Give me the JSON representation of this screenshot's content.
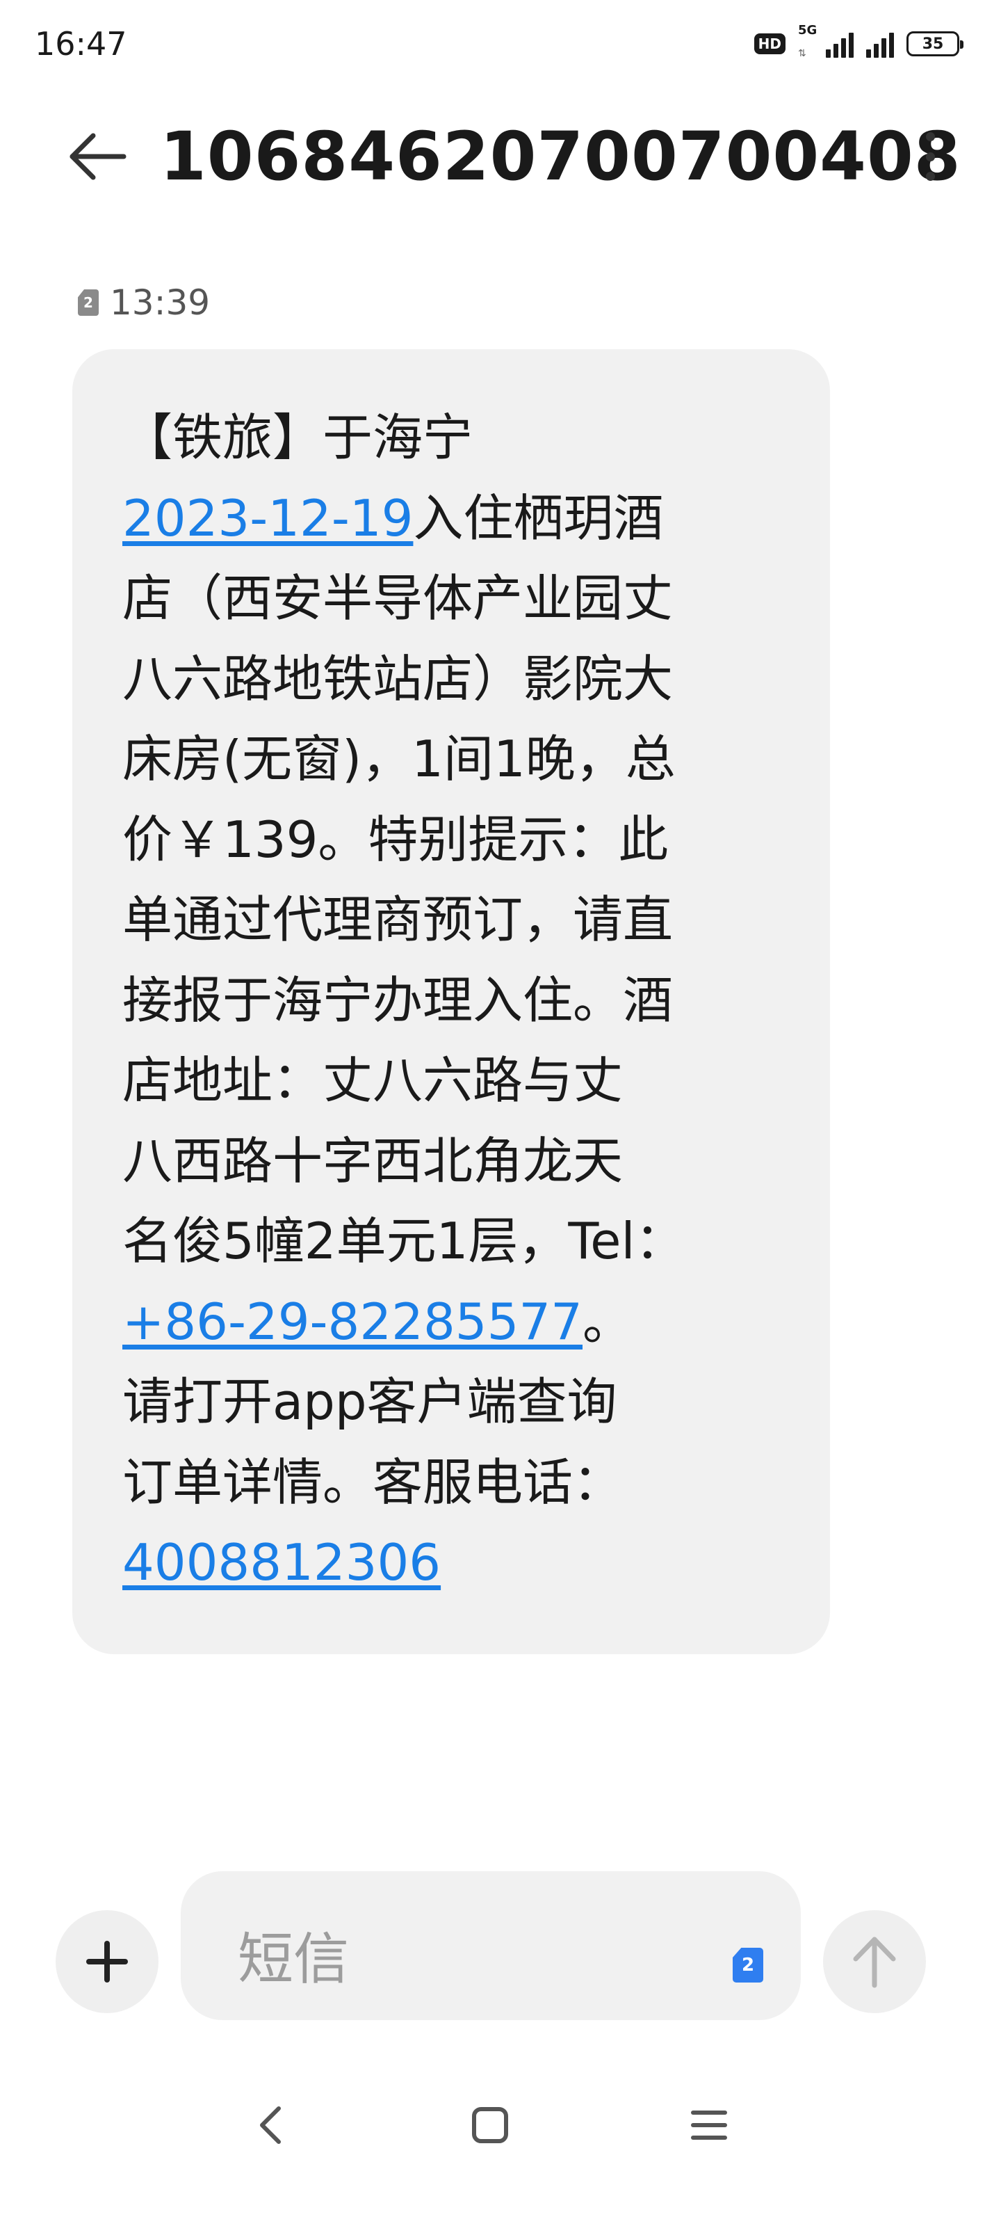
{
  "status_bar": {
    "time": "16:47",
    "hd_label": "HD",
    "network_label": "5G",
    "battery_level": "35"
  },
  "header": {
    "title": "10684620700700408"
  },
  "message": {
    "sim_slot": "2",
    "time": "13:39",
    "segments": [
      {
        "text": "【铁旅】于海宁\n",
        "link": false
      },
      {
        "text": "2023-12-19",
        "link": true
      },
      {
        "text": "入住栖玥酒\n店（西安半导体产业园丈\n八六路地铁站店）影院大\n床房(无窗)，1间1晚，总\n价￥139。特别提示：此\n单通过代理商预订，请直\n接报于海宁办理入住。酒\n店地址：丈八六路与丈\n八西路十字西北角龙天\n名俊5幢2单元1层，Tel：\n",
        "link": false
      },
      {
        "text": "+86-29-82285577",
        "link": true
      },
      {
        "text": "。\n请打开app客户端查询\n订单详情。客服电话：\n",
        "link": false
      },
      {
        "text": "4008812306",
        "link": true
      }
    ]
  },
  "composer": {
    "placeholder": "短信",
    "sim_slot": "2"
  },
  "icons": {
    "back": "arrow-left-icon",
    "more": "more-vertical-icon",
    "add": "plus-icon",
    "send": "arrow-up-icon",
    "nav_back": "chevron-left-icon",
    "nav_home": "square-icon",
    "nav_menu": "menu-icon"
  }
}
